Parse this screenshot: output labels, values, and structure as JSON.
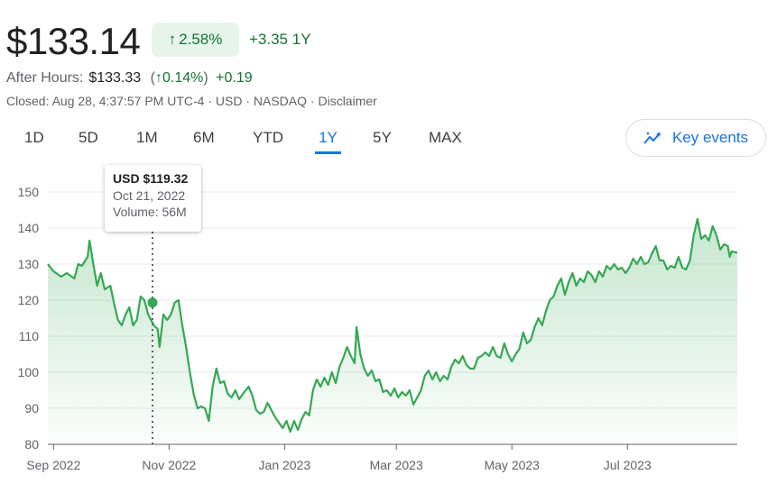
{
  "header": {
    "price": "$133.14",
    "change_pct": "2.58%",
    "change_abs": "+3.35",
    "change_period": "1Y",
    "after_hours_label": "After Hours:",
    "after_hours_price": "$133.33",
    "after_hours_pct": "0.14%",
    "after_hours_abs": "+0.19",
    "closed_text": "Closed: Aug 28, 4:37:57 PM UTC-4 · USD · NASDAQ · ",
    "disclaimer": "Disclaimer"
  },
  "tabs": [
    "1D",
    "5D",
    "1M",
    "6M",
    "YTD",
    "1Y",
    "5Y",
    "MAX"
  ],
  "active_tab": "1Y",
  "key_events_label": "Key events",
  "tooltip": {
    "price": "USD $119.32",
    "date": "Oct 21, 2022",
    "volume": "Volume: 56M"
  },
  "colors": {
    "up_green": "#137333",
    "line_green": "#34a853",
    "accent_blue": "#1a73e8"
  },
  "chart_data": {
    "type": "area",
    "title": "",
    "xlabel": "",
    "ylabel": "",
    "ylim": [
      80,
      150
    ],
    "yticks": [
      80,
      90,
      100,
      110,
      120,
      130,
      140,
      150
    ],
    "x_tick_labels": [
      "Sep 2022",
      "Nov 2022",
      "Jan 2023",
      "Mar 2023",
      "May 2023",
      "Jul 2023"
    ],
    "x_tick_dates": [
      "2022-09-01",
      "2022-11-01",
      "2023-01-01",
      "2023-03-01",
      "2023-05-01",
      "2023-07-01"
    ],
    "x_range": [
      "2022-08-29",
      "2023-08-28"
    ],
    "highlight": {
      "date": "2022-10-21",
      "value": 119.32
    },
    "grid": true,
    "series": [
      {
        "values": [
          [
            "2022-08-29",
            130
          ],
          [
            "2022-09-01",
            128
          ],
          [
            "2022-09-05",
            126.5
          ],
          [
            "2022-09-08",
            127.5
          ],
          [
            "2022-09-12",
            126
          ],
          [
            "2022-09-14",
            130
          ],
          [
            "2022-09-16",
            129.5
          ],
          [
            "2022-09-19",
            132
          ],
          [
            "2022-09-20",
            136.5
          ],
          [
            "2022-09-22",
            130
          ],
          [
            "2022-09-24",
            124
          ],
          [
            "2022-09-26",
            127.5
          ],
          [
            "2022-09-28",
            123
          ],
          [
            "2022-10-01",
            124
          ],
          [
            "2022-10-03",
            119
          ],
          [
            "2022-10-05",
            114.5
          ],
          [
            "2022-10-07",
            113
          ],
          [
            "2022-10-09",
            116
          ],
          [
            "2022-10-11",
            118
          ],
          [
            "2022-10-13",
            113
          ],
          [
            "2022-10-15",
            114.5
          ],
          [
            "2022-10-17",
            121
          ],
          [
            "2022-10-19",
            120
          ],
          [
            "2022-10-21",
            116
          ],
          [
            "2022-10-24",
            113
          ],
          [
            "2022-10-26",
            112
          ],
          [
            "2022-10-27",
            107
          ],
          [
            "2022-10-29",
            116
          ],
          [
            "2022-10-31",
            114.5
          ],
          [
            "2022-11-02",
            116
          ],
          [
            "2022-11-04",
            119.32
          ],
          [
            "2022-11-06",
            120
          ],
          [
            "2022-11-08",
            113
          ],
          [
            "2022-11-10",
            107
          ],
          [
            "2022-11-12",
            100
          ],
          [
            "2022-11-14",
            94
          ],
          [
            "2022-11-16",
            90
          ],
          [
            "2022-11-18",
            90.5
          ],
          [
            "2022-11-20",
            90
          ],
          [
            "2022-11-22",
            86.5
          ],
          [
            "2022-11-24",
            96
          ],
          [
            "2022-11-26",
            101
          ],
          [
            "2022-11-28",
            97
          ],
          [
            "2022-11-30",
            97.5
          ],
          [
            "2022-12-02",
            94
          ],
          [
            "2022-12-04",
            93
          ],
          [
            "2022-12-06",
            95
          ],
          [
            "2022-12-08",
            92.5
          ],
          [
            "2022-12-10",
            94
          ],
          [
            "2022-12-13",
            96
          ],
          [
            "2022-12-15",
            93.5
          ],
          [
            "2022-12-17",
            89.5
          ],
          [
            "2022-12-19",
            88.5
          ],
          [
            "2022-12-21",
            89
          ],
          [
            "2022-12-23",
            91.5
          ],
          [
            "2022-12-25",
            89.5
          ],
          [
            "2022-12-27",
            87.5
          ],
          [
            "2022-12-29",
            86
          ],
          [
            "2022-12-31",
            84.5
          ],
          [
            "2023-01-02",
            86.5
          ],
          [
            "2023-01-04",
            83.5
          ],
          [
            "2023-01-06",
            86.5
          ],
          [
            "2023-01-08",
            84
          ],
          [
            "2023-01-10",
            87
          ],
          [
            "2023-01-12",
            89
          ],
          [
            "2023-01-14",
            88
          ],
          [
            "2023-01-16",
            95
          ],
          [
            "2023-01-18",
            98
          ],
          [
            "2023-01-20",
            96
          ],
          [
            "2023-01-22",
            98.5
          ],
          [
            "2023-01-24",
            96.5
          ],
          [
            "2023-01-26",
            100
          ],
          [
            "2023-01-28",
            97
          ],
          [
            "2023-01-30",
            101.5
          ],
          [
            "2023-02-01",
            104
          ],
          [
            "2023-02-03",
            107
          ],
          [
            "2023-02-05",
            104.5
          ],
          [
            "2023-02-07",
            102.5
          ],
          [
            "2023-02-08",
            112.5
          ],
          [
            "2023-02-10",
            105
          ],
          [
            "2023-02-12",
            101
          ],
          [
            "2023-02-14",
            99
          ],
          [
            "2023-02-16",
            100.5
          ],
          [
            "2023-02-18",
            97.5
          ],
          [
            "2023-02-20",
            98
          ],
          [
            "2023-02-22",
            94.5
          ],
          [
            "2023-02-24",
            95
          ],
          [
            "2023-02-26",
            93.5
          ],
          [
            "2023-02-28",
            95.5
          ],
          [
            "2023-03-02",
            93
          ],
          [
            "2023-03-04",
            94.5
          ],
          [
            "2023-03-06",
            93.5
          ],
          [
            "2023-03-08",
            95
          ],
          [
            "2023-03-10",
            91
          ],
          [
            "2023-03-12",
            93
          ],
          [
            "2023-03-14",
            95
          ],
          [
            "2023-03-16",
            99
          ],
          [
            "2023-03-18",
            100.5
          ],
          [
            "2023-03-20",
            98
          ],
          [
            "2023-03-22",
            100
          ],
          [
            "2023-03-24",
            97.5
          ],
          [
            "2023-03-26",
            99
          ],
          [
            "2023-03-28",
            98
          ],
          [
            "2023-03-30",
            101.5
          ],
          [
            "2023-04-01",
            103.5
          ],
          [
            "2023-04-03",
            102.5
          ],
          [
            "2023-04-05",
            104.5
          ],
          [
            "2023-04-07",
            102
          ],
          [
            "2023-04-09",
            101
          ],
          [
            "2023-04-11",
            101
          ],
          [
            "2023-04-13",
            104
          ],
          [
            "2023-04-15",
            104.5
          ],
          [
            "2023-04-17",
            105.5
          ],
          [
            "2023-04-19",
            104.5
          ],
          [
            "2023-04-21",
            107
          ],
          [
            "2023-04-23",
            104.5
          ],
          [
            "2023-04-25",
            104
          ],
          [
            "2023-04-27",
            108
          ],
          [
            "2023-04-29",
            105
          ],
          [
            "2023-05-01",
            103
          ],
          [
            "2023-05-03",
            105
          ],
          [
            "2023-05-05",
            106.5
          ],
          [
            "2023-05-07",
            111
          ],
          [
            "2023-05-09",
            108
          ],
          [
            "2023-05-11",
            109
          ],
          [
            "2023-05-13",
            112.5
          ],
          [
            "2023-05-15",
            115
          ],
          [
            "2023-05-17",
            113
          ],
          [
            "2023-05-19",
            117
          ],
          [
            "2023-05-21",
            120
          ],
          [
            "2023-05-23",
            121
          ],
          [
            "2023-05-25",
            124
          ],
          [
            "2023-05-27",
            126
          ],
          [
            "2023-05-29",
            121.5
          ],
          [
            "2023-05-31",
            125
          ],
          [
            "2023-06-02",
            127.5
          ],
          [
            "2023-06-04",
            124
          ],
          [
            "2023-06-06",
            126
          ],
          [
            "2023-06-08",
            125
          ],
          [
            "2023-06-10",
            128
          ],
          [
            "2023-06-12",
            127
          ],
          [
            "2023-06-14",
            125
          ],
          [
            "2023-06-16",
            128
          ],
          [
            "2023-06-18",
            126.5
          ],
          [
            "2023-06-20",
            129.5
          ],
          [
            "2023-06-22",
            128.5
          ],
          [
            "2023-06-24",
            130
          ],
          [
            "2023-06-26",
            128.5
          ],
          [
            "2023-06-28",
            129
          ],
          [
            "2023-06-30",
            127.5
          ],
          [
            "2023-07-02",
            129
          ],
          [
            "2023-07-04",
            131.5
          ],
          [
            "2023-07-06",
            130
          ],
          [
            "2023-07-08",
            132
          ],
          [
            "2023-07-10",
            130
          ],
          [
            "2023-07-12",
            130.5
          ],
          [
            "2023-07-14",
            133
          ],
          [
            "2023-07-16",
            135
          ],
          [
            "2023-07-18",
            131
          ],
          [
            "2023-07-20",
            131
          ],
          [
            "2023-07-22",
            128.5
          ],
          [
            "2023-07-24",
            129.5
          ],
          [
            "2023-07-26",
            129
          ],
          [
            "2023-07-28",
            132
          ],
          [
            "2023-07-30",
            129
          ],
          [
            "2023-08-01",
            128.5
          ],
          [
            "2023-08-03",
            131
          ],
          [
            "2023-08-05",
            138
          ],
          [
            "2023-08-07",
            142.5
          ],
          [
            "2023-08-09",
            137
          ],
          [
            "2023-08-11",
            138
          ],
          [
            "2023-08-13",
            136.5
          ],
          [
            "2023-08-15",
            140.5
          ],
          [
            "2023-08-17",
            138
          ],
          [
            "2023-08-19",
            134
          ],
          [
            "2023-08-21",
            135.5
          ],
          [
            "2023-08-23",
            135
          ],
          [
            "2023-08-24",
            132
          ],
          [
            "2023-08-25",
            133.5
          ],
          [
            "2023-08-28",
            133.14
          ]
        ]
      }
    ]
  }
}
